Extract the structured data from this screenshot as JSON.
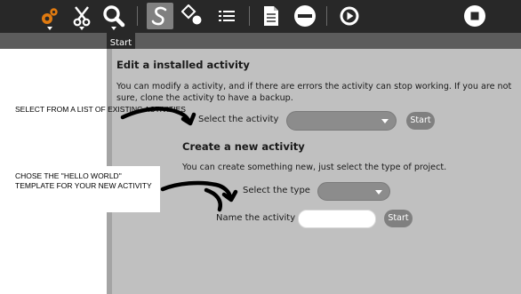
{
  "toolbar": {
    "icons": [
      "activity-gear-icon",
      "cut-icon",
      "search-icon",
      "edit-s-icon",
      "shapes-icon",
      "list-icon",
      "document-icon",
      "stop-minus-icon",
      "play-icon",
      "stop-icon"
    ]
  },
  "tab": {
    "label": "Start"
  },
  "edit_section": {
    "title": "Edit a installed activity",
    "description": "You can modify a activity, and if there are errors the activity can stop working. If you are not sure, clone the activity to have a backup.",
    "select_label": "Select the activity",
    "select_value": "",
    "start_button": "Start"
  },
  "create_section": {
    "title": "Create a new activity",
    "description": "You can create something new, just select the type of project.",
    "type_label": "Select the type",
    "type_value": "",
    "name_label": "Name the activity",
    "name_value": "",
    "start_button": "Start"
  },
  "annotations": {
    "note1": "SELECT FROM A LIST OF EXISTING ACTIVITIES",
    "note2": "CHOSE THE \"HELLO WORLD\" TEMPLATE FOR YOUR NEW ACTIVITY"
  },
  "colors": {
    "toolbar_bg": "#282828",
    "content_bg": "#c0c0c0",
    "button_bg": "#808080",
    "accent_orange": "#e07a10"
  }
}
